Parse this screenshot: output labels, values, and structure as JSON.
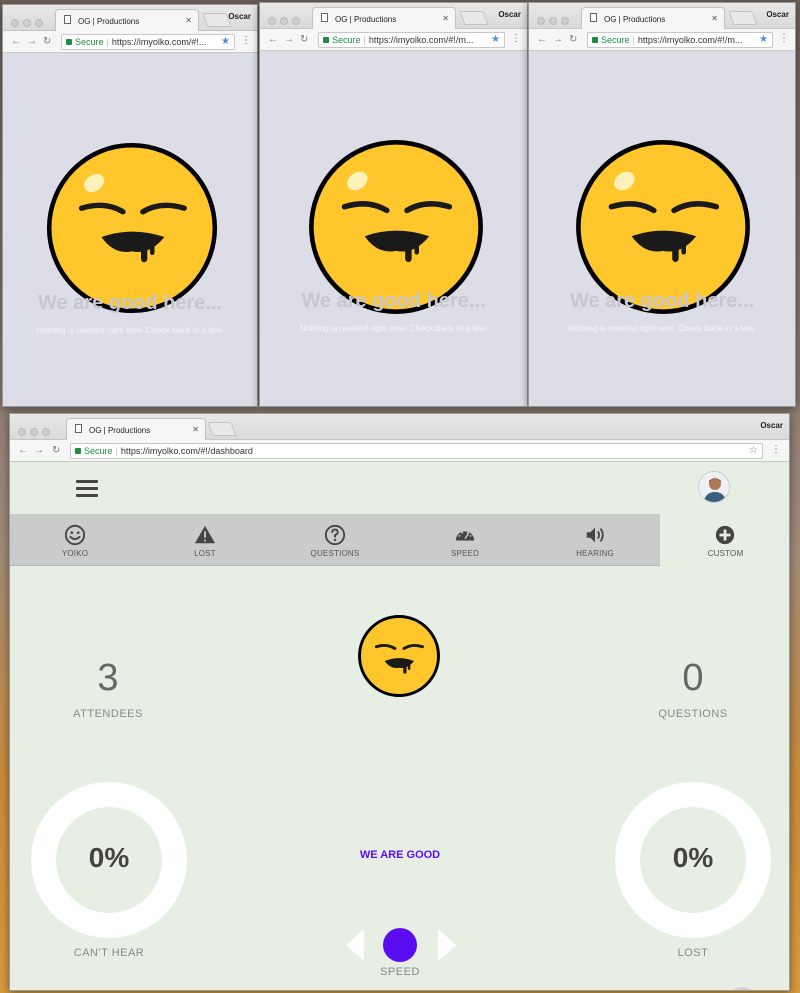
{
  "windows": [
    {
      "tab_title": "OG | Productions",
      "profile": "Oscar",
      "secure_label": "Secure",
      "url": "https://imyolko.com/#!...",
      "heading": "We are good here...",
      "subtext": "Nothing is needed right now. Check back in a few."
    },
    {
      "tab_title": "OG | Productions",
      "profile": "Oscar",
      "secure_label": "Secure",
      "url": "https://imyolko.com/#!/m...",
      "heading": "We are good here...",
      "subtext": "Nothing is needed right now. Check back in a few."
    },
    {
      "tab_title": "OG | Productions",
      "profile": "Oscar",
      "secure_label": "Secure",
      "url": "https://imyolko.com/#!/m...",
      "heading": "We are good here...",
      "subtext": "Nothing is needed right now. Check back in a few."
    }
  ],
  "dashboard": {
    "tab_title": "OG | Productions",
    "profile": "Oscar",
    "secure_label": "Secure",
    "url": "https://imyolko.com/#!/dashboard",
    "modes": [
      {
        "label": "YOIKO",
        "icon": "smiley-icon"
      },
      {
        "label": "LOST",
        "icon": "warning-icon"
      },
      {
        "label": "QUESTIONS",
        "icon": "question-icon"
      },
      {
        "label": "SPEED",
        "icon": "speedometer-icon"
      },
      {
        "label": "HEARING",
        "icon": "speaker-icon"
      },
      {
        "label": "CUSTOM",
        "icon": "plus-icon"
      }
    ],
    "active_mode": "CUSTOM",
    "attendees": {
      "value": "3",
      "label": "ATTENDEES"
    },
    "questions": {
      "value": "0",
      "label": "QUESTIONS"
    },
    "cant_hear": {
      "value": "0%",
      "label": "CAN'T HEAR"
    },
    "lost": {
      "value": "0%",
      "label": "LOST"
    },
    "status": "WE ARE GOOD",
    "speed_label": "SPEED"
  },
  "colors": {
    "face": "#ffc72c",
    "accent": "#5a0df0",
    "dash_bg": "#e7efe5",
    "window_bg": "#dcdde6"
  }
}
